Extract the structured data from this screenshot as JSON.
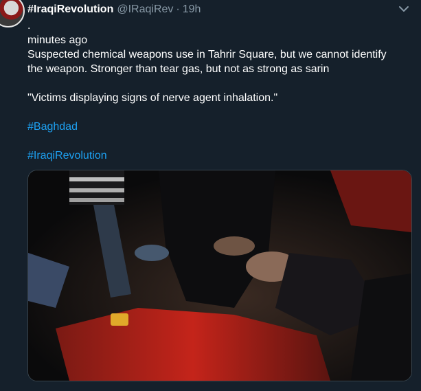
{
  "tweet": {
    "display_name": "#IraqiRevolution",
    "handle": "@IRaqiRev",
    "separator": "·",
    "time": "19h",
    "text_lines": [
      ".",
      "minutes ago",
      "Suspected chemical weapons use in Tahrir Square, but we cannot identify",
      "the weapon. Stronger than tear gas, but not as strong as sarin",
      "\"Victims displaying signs of nerve agent inhalation.\""
    ],
    "hashtags": [
      "#Baghdad",
      "#IraqiRevolution"
    ],
    "icons": {
      "menu": "chevron-down-icon"
    }
  },
  "colors": {
    "background": "#15202b",
    "text": "#ffffff",
    "secondary": "#8899a6",
    "link": "#1da1f2",
    "border": "#38444d"
  }
}
